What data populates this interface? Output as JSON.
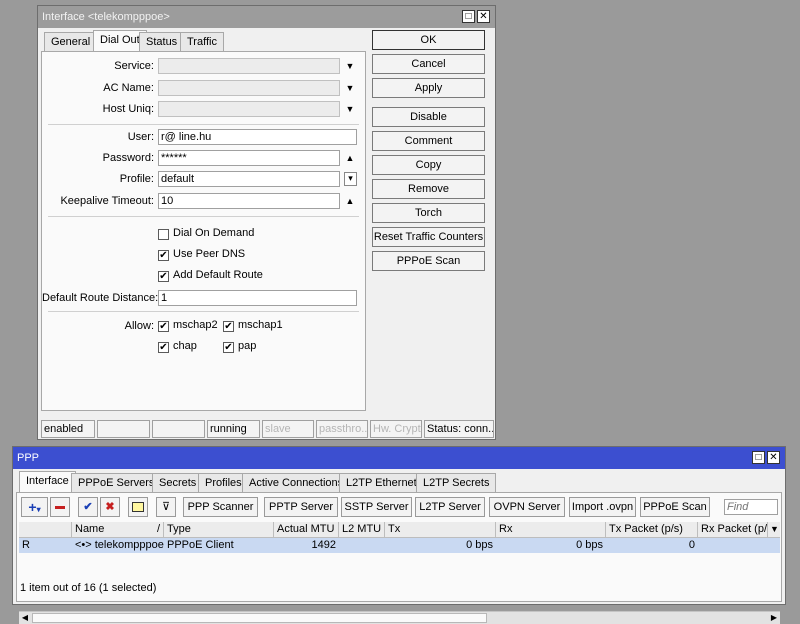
{
  "interface_window": {
    "title": "Interface <telekompppoe>",
    "tabs": [
      "General",
      "Dial Out",
      "Status",
      "Traffic"
    ],
    "active_tab": "Dial Out",
    "fields": {
      "service": {
        "label": "Service:",
        "value": ""
      },
      "ac_name": {
        "label": "AC Name:",
        "value": ""
      },
      "host_uniq": {
        "label": "Host Uniq:",
        "value": ""
      },
      "user": {
        "label": "User:",
        "value": "             r@      line.hu"
      },
      "password": {
        "label": "Password:",
        "value": "******"
      },
      "profile": {
        "label": "Profile:",
        "value": "default"
      },
      "keepalive": {
        "label": "Keepalive Timeout:",
        "value": "10"
      },
      "route_distance": {
        "label": "Default Route Distance:",
        "value": "1"
      }
    },
    "checkboxes": {
      "dial_on_demand": {
        "label": "Dial On Demand",
        "checked": false
      },
      "use_peer_dns": {
        "label": "Use Peer DNS",
        "checked": true
      },
      "add_default_route": {
        "label": "Add Default Route",
        "checked": true
      }
    },
    "allow": {
      "label": "Allow:",
      "mschap2": {
        "label": "mschap2",
        "checked": true
      },
      "mschap1": {
        "label": "mschap1",
        "checked": true
      },
      "chap": {
        "label": "chap",
        "checked": true
      },
      "pap": {
        "label": "pap",
        "checked": true
      }
    },
    "buttons": {
      "ok": "OK",
      "cancel": "Cancel",
      "apply": "Apply",
      "disable": "Disable",
      "comment": "Comment",
      "copy": "Copy",
      "remove": "Remove",
      "torch": "Torch",
      "reset_counters": "Reset Traffic Counters",
      "pppoe_scan": "PPPoE Scan"
    },
    "status_bar": {
      "enabled": "enabled",
      "running": "running",
      "slave": "slave",
      "passthrough": "passthro...",
      "hw_crypto": "Hw. Crypto",
      "status": "Status: conn..."
    }
  },
  "ppp_window": {
    "title": "PPP",
    "tabs": [
      "Interface",
      "PPPoE Servers",
      "Secrets",
      "Profiles",
      "Active Connections",
      "L2TP Ethernet",
      "L2TP Secrets"
    ],
    "active_tab": "Interface",
    "toolbar": {
      "ppp_scanner": "PPP Scanner",
      "pptp_server": "PPTP Server",
      "sstp_server": "SSTP Server",
      "l2tp_server": "L2TP Server",
      "ovpn_server": "OVPN Server",
      "import_ovpn": "Import .ovpn",
      "pppoe_scan": "PPPoE Scan",
      "find_placeholder": "Find"
    },
    "columns": [
      "Name",
      "Type",
      "Actual MTU",
      "L2 MTU",
      "Tx",
      "Rx",
      "Tx Packet (p/s)",
      "Rx Packet (p/s"
    ],
    "rows": [
      {
        "flag": "R",
        "name": "<•> telekompppoe",
        "type": "PPPoE Client",
        "actual_mtu": "1492",
        "l2_mtu": "",
        "tx": "0 bps",
        "rx": "0 bps",
        "tx_packet": "0",
        "rx_packet": ""
      }
    ],
    "status": "1 item out of 16 (1 selected)"
  },
  "colors": {
    "ppp_titlebar": "#3c4fd0",
    "selected_row": "#c9d9f2",
    "desktop": "#9a9a9a"
  }
}
